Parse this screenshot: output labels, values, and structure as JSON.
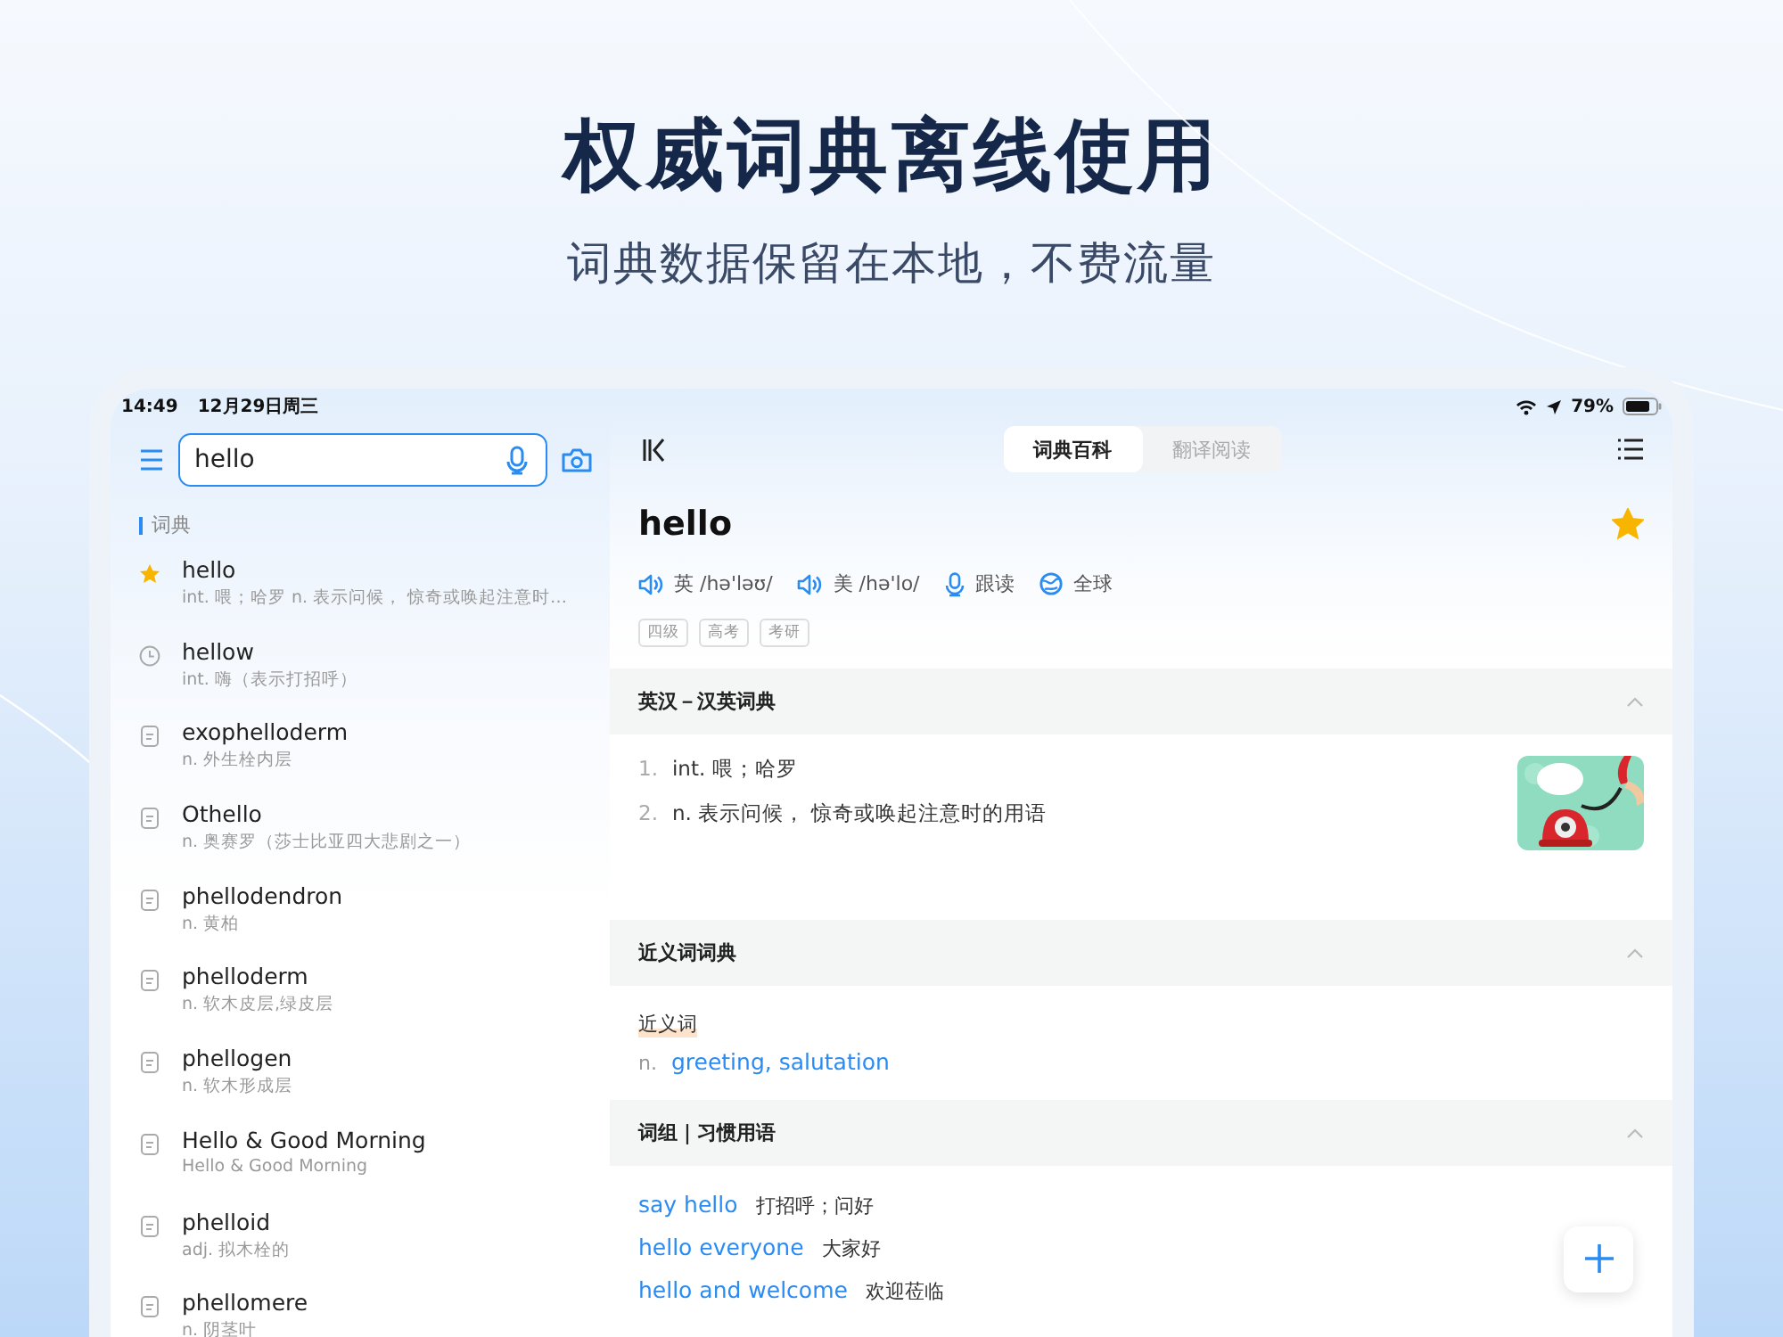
{
  "headline": "权威词典离线使用",
  "subheadline": "词典数据保留在本地，不费流量",
  "status_bar": {
    "time": "14:49",
    "date": "12月29日周三",
    "battery": "79%"
  },
  "search": {
    "value": "hello"
  },
  "section_label": "词典",
  "results": [
    {
      "kind": "favorite",
      "word": "hello",
      "gloss": "int. 喂；哈罗 n. 表示问候， 惊奇或唤起注意时…"
    },
    {
      "kind": "history",
      "word": "hellow",
      "gloss": "int. 嗨（表示打招呼）"
    },
    {
      "kind": "entry",
      "word": "exophelloderm",
      "gloss": "n. 外生栓内层"
    },
    {
      "kind": "entry",
      "word": "Othello",
      "gloss": "n. 奥赛罗（莎士比亚四大悲剧之一）"
    },
    {
      "kind": "entry",
      "word": "phellodendron",
      "gloss": "n. 黄柏"
    },
    {
      "kind": "entry",
      "word": "phelloderm",
      "gloss": "n. 软木皮层,绿皮层"
    },
    {
      "kind": "entry",
      "word": "phellogen",
      "gloss": "n. 软木形成层"
    },
    {
      "kind": "entry",
      "word": "Hello & Good Morning",
      "gloss": "Hello & Good Morning"
    },
    {
      "kind": "entry",
      "word": "phelloid",
      "gloss": "adj. 拟木栓的"
    },
    {
      "kind": "entry",
      "word": "phellomere",
      "gloss": "n. 阴茎叶"
    }
  ],
  "tabs": [
    {
      "label": "词典百科",
      "selected": true
    },
    {
      "label": "翻译阅读",
      "selected": false
    }
  ],
  "entry": {
    "word": "hello",
    "favorited": true,
    "pronunciations": [
      {
        "kind": "speaker",
        "label": "英 /hə'ləʊ/"
      },
      {
        "kind": "speaker",
        "label": "美 /hə'lo/"
      },
      {
        "kind": "mic",
        "label": "跟读"
      },
      {
        "kind": "globe",
        "label": "全球"
      }
    ],
    "tags": [
      "四级",
      "高考",
      "考研"
    ]
  },
  "sections": [
    {
      "kind": "definitions",
      "title": "英汉－汉英词典",
      "expanded": true,
      "items": [
        {
          "number": "1.",
          "text": "int. 喂；哈罗"
        },
        {
          "number": "2.",
          "text": "n. 表示问候， 惊奇或唤起注意时的用语"
        }
      ],
      "image": {
        "kind": "picture"
      }
    },
    {
      "kind": "synonyms",
      "title": "近义词词典",
      "expanded": true,
      "label": "近义词",
      "pos": "n.",
      "words": "greeting, salutation"
    },
    {
      "kind": "phrases",
      "title": "词组｜习惯用语",
      "expanded": true,
      "items": [
        {
          "phrase": "say hello",
          "meaning": "打招呼；问好"
        },
        {
          "phrase": "hello everyone",
          "meaning": "大家好"
        },
        {
          "phrase": "hello and welcome",
          "meaning": "欢迎莅临"
        }
      ]
    }
  ]
}
